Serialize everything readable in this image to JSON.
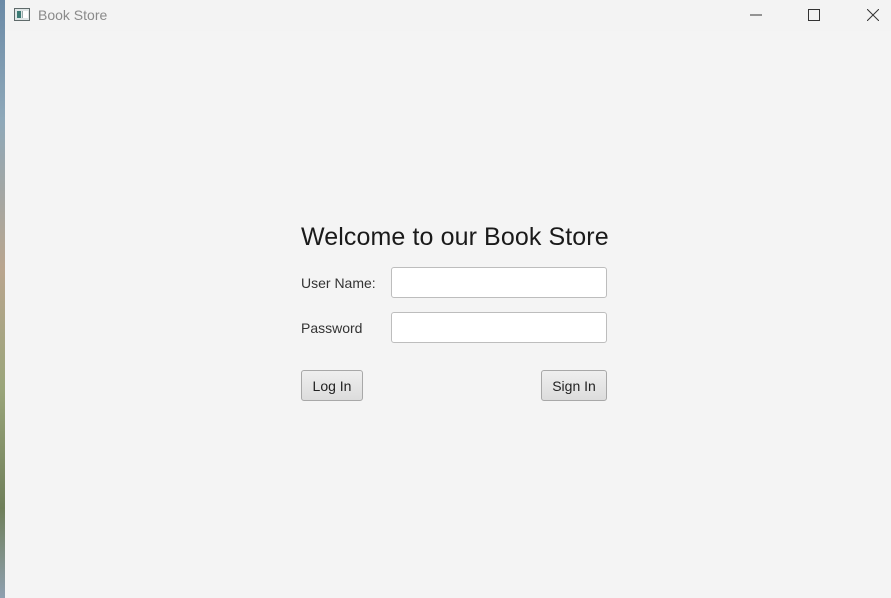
{
  "window": {
    "title": "Book Store",
    "controls": {
      "minimize": "minimize-icon",
      "maximize": "maximize-icon",
      "close": "close-icon"
    }
  },
  "form": {
    "heading": "Welcome to our Book Store",
    "username_label": "User Name:",
    "username_value": "",
    "password_label": "Password",
    "password_value": "",
    "login_button": "Log In",
    "signin_button": "Sign In"
  },
  "colors": {
    "background": "#f4f4f4",
    "text": "#1a1a1a",
    "title_text": "#8a8a8a",
    "field_border": "#bdbdbd"
  }
}
